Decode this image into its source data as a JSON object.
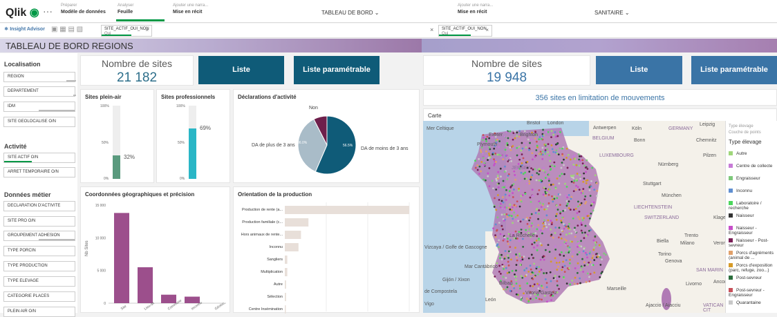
{
  "app": {
    "logo": "Qlik",
    "more": "···"
  },
  "steps": [
    {
      "small": "Préparer",
      "label": "Modèle de données"
    },
    {
      "small": "Analyser",
      "label": "Feuille"
    },
    {
      "small": "Ajouter une narra...",
      "label": "Mise en récit"
    },
    {
      "small": "Ajouter une narra...",
      "label": "Mise en récit"
    }
  ],
  "sheets": {
    "left": "TABLEAU DE BORD",
    "right": "SANITAIRE"
  },
  "toolbar": {
    "insight": "Insight Advisor",
    "chip_field": "SITE_ACTIF_OUI_NON",
    "chip_value": "Oui"
  },
  "banner": {
    "left": "TABLEAU DE BORD REGIONS"
  },
  "sidebar": {
    "localisation": "Localisation",
    "loc_filters": [
      "REGION",
      "DEPARTEMENT",
      "IDM",
      "SITE GEOLOCALISE O/N"
    ],
    "activite": "Activité",
    "act_filters": [
      "SITE ACTIF O/N",
      "ARRET TEMPORAIRE O/N"
    ],
    "metier": "Données métier",
    "met_filters": [
      "DECLARATION D'ACTIVITE",
      "SITE PRO O/N",
      "GROUPEMENT ADHESION",
      "TYPE PORCIN",
      "TYPE PRODUCTION",
      "TYPE ELEVAGE",
      "CATEGORIE PLACES",
      "PLEIN AIR O/N"
    ]
  },
  "left": {
    "kpi_title": "Nombre de sites",
    "kpi_value": "21 182",
    "btn_liste": "Liste",
    "btn_param": "Liste paramétrable",
    "plein_air": {
      "title": "Sites plein-air",
      "top": "100%",
      "mid": "50%",
      "bot": "0%",
      "value": "32%",
      "pct": 0.32
    },
    "pro": {
      "title": "Sites professionnels",
      "top": "100%",
      "mid": "50%",
      "bot": "0%",
      "value": "69%",
      "pct": 0.69
    },
    "decl": {
      "title": "Déclarations d'activité",
      "non": "Non",
      "plus": "DA de plus de 3 ans",
      "moins": "DA de moins de 3 ans",
      "pct_plus": "36.0%",
      "pct_moins": "56.5%"
    },
    "coord": {
      "title": "Coordonnées géographiques et précision",
      "ylabel": "Nb Sites"
    },
    "orient": {
      "title": "Orientation de la production"
    }
  },
  "right": {
    "kpi_title": "Nombre de sites",
    "kpi_value": "19 948",
    "btn_liste": "Liste",
    "btn_param": "Liste paramétrable",
    "limit": "356 sites en limitation de mouvements",
    "carte": "Carte",
    "map_labels": [
      "Bristol",
      "London",
      "Exeter",
      "Brighton",
      "Plymouth",
      "Antwerpen",
      "Köln",
      "GERMANY",
      "Leipzig",
      "BELGIUM",
      "Bonn",
      "Chemnitz",
      "LUXEMBOURG",
      "Nürnberg",
      "Pilzen",
      "JERSEY",
      "Stuttgart",
      "München",
      "LIECHTENSTEIN",
      "SWITZERLAND",
      "Klagenf",
      "La Rochelle",
      "Biella",
      "Milano",
      "Verona",
      "Trento",
      "Torino",
      "Genova",
      "SAN MARIN",
      "Livorno",
      "Ancona",
      "Vizcaya / Golfe de Gascogne",
      "Mar Cantábrico",
      "Gijón / Xixon",
      "Bilbao",
      "Vitoria-Gasteiz",
      "de Compostela",
      "León",
      "Vigo",
      "Marseille",
      "Ajaccio / Aiacciu",
      "VATICAN CIT",
      "Mer Celtique"
    ],
    "legend": {
      "t1": "Type élevage",
      "t2": "Couche de points",
      "t3": "Type élevage",
      "items": [
        {
          "label": "Autre",
          "color": "#9fd67a"
        },
        {
          "label": "Centre de collecte",
          "color": "#c77bd6"
        },
        {
          "label": "Engraisseur",
          "color": "#7ec97b"
        },
        {
          "label": "Inconnu",
          "color": "#5f8fd1"
        },
        {
          "label": "Laboratoire / recherche",
          "color": "#4cd65c"
        },
        {
          "label": "Naisseur",
          "color": "#333333"
        },
        {
          "label": "Naisseur - Engraisseur",
          "color": "#c64fc9"
        },
        {
          "label": "Naisseur - Post-sevreur",
          "color": "#7a1f57"
        },
        {
          "label": "Porcs d'agréments (animal de ...",
          "color": "#e0a06a"
        },
        {
          "label": "Porcs d'exposition (parc, refuge, zoo...)",
          "color": "#d69a28"
        },
        {
          "label": "Post-sevreur",
          "color": "#2b6e3c"
        },
        {
          "label": "Post-sevreur - Engraisseur",
          "color": "#c8505a"
        },
        {
          "label": "Quarantaine",
          "color": "#c9c9c9"
        }
      ]
    }
  },
  "chart_data": [
    {
      "type": "pie",
      "title": "Déclarations d'activité",
      "categories": [
        "DA de moins de 3 ans",
        "DA de plus de 3 ans",
        "Non"
      ],
      "values": [
        56.5,
        36.0,
        7.5
      ]
    },
    {
      "type": "bar",
      "title": "Coordonnées géographiques et précision",
      "ylabel": "Nb Sites",
      "ylim": [
        0,
        15000
      ],
      "yticks": [
        "15 000",
        "10 000",
        "5 000",
        "0"
      ],
      "categories": [
        "Site",
        "Lieu-dit",
        "Commune",
        "Inconnu",
        "Géoloc."
      ],
      "values": [
        13800,
        5500,
        1300,
        1000,
        0
      ]
    },
    {
      "type": "bar",
      "orientation": "horizontal",
      "title": "Orientation de la production",
      "categories": [
        "Production de rente (a...",
        "Production familiale (c...",
        "Hors animaux de rente...",
        "Inconnu",
        "Sangliers",
        "Multiplication",
        "Autre",
        "Sélection",
        "Centre Insémination"
      ],
      "values": [
        100,
        19,
        13,
        11,
        2,
        2,
        1,
        1,
        0.5
      ]
    }
  ],
  "colors": {
    "teal": "#0f5b78",
    "blue": "#3a74a6",
    "green": "#009845",
    "purple": "#9c4f8c",
    "beige": "#e8dfd9"
  }
}
